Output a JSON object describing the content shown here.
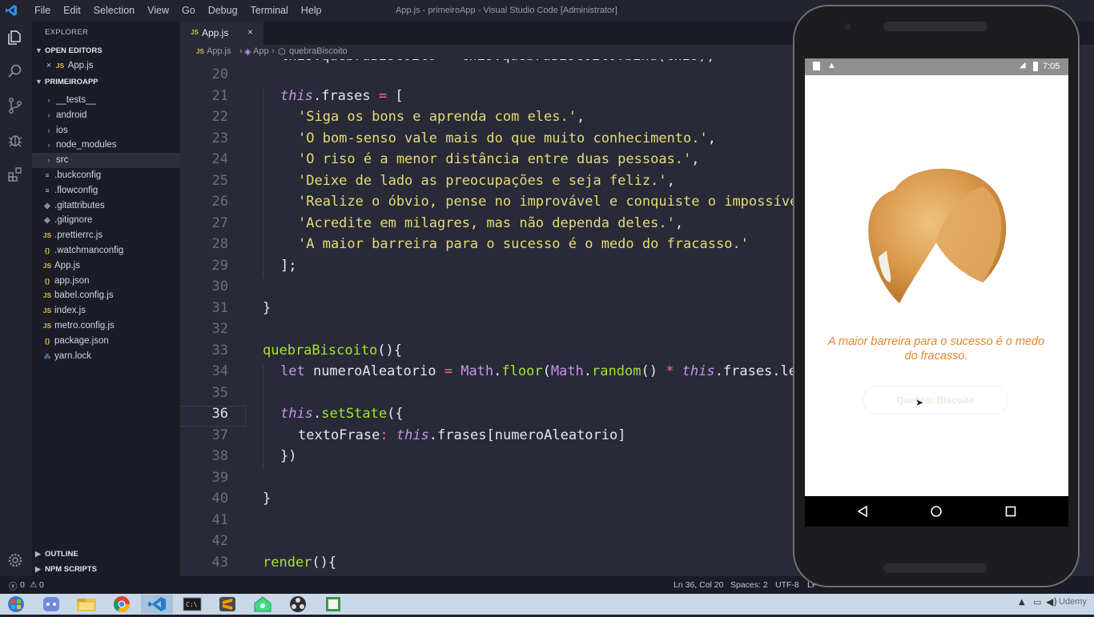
{
  "menu": [
    "File",
    "Edit",
    "Selection",
    "View",
    "Go",
    "Debug",
    "Terminal",
    "Help"
  ],
  "window_title": "App.js - primeiroApp - Visual Studio Code [Administrator]",
  "explorer": {
    "header": "EXPLORER",
    "open_editors_label": "OPEN EDITORS",
    "open_editors": [
      {
        "icon": "JS",
        "name": "App.js"
      }
    ],
    "project_label": "PRIMEIROAPP",
    "items": [
      {
        "type": "folder",
        "name": "__tests__"
      },
      {
        "type": "folder",
        "name": "android"
      },
      {
        "type": "folder",
        "name": "ios"
      },
      {
        "type": "folder",
        "name": "node_modules"
      },
      {
        "type": "folder",
        "name": "src"
      },
      {
        "type": "file",
        "icon": "≡",
        "name": ".buckconfig"
      },
      {
        "type": "file",
        "icon": "≡",
        "name": ".flowconfig"
      },
      {
        "type": "file",
        "icon": "◆",
        "name": ".gitattributes"
      },
      {
        "type": "file",
        "icon": "◆",
        "name": ".gitignore"
      },
      {
        "type": "file",
        "icon": "JS",
        "name": ".prettierrc.js"
      },
      {
        "type": "file",
        "icon": "{}",
        "name": ".watchmanconfig"
      },
      {
        "type": "file",
        "icon": "JS",
        "name": "App.js"
      },
      {
        "type": "file",
        "icon": "{}",
        "name": "app.json"
      },
      {
        "type": "file",
        "icon": "JS",
        "name": "babel.config.js"
      },
      {
        "type": "file",
        "icon": "JS",
        "name": "index.js"
      },
      {
        "type": "file",
        "icon": "JS",
        "name": "metro.config.js"
      },
      {
        "type": "file",
        "icon": "{}",
        "name": "package.json"
      },
      {
        "type": "file",
        "icon": "🧶",
        "name": "yarn.lock"
      }
    ],
    "outline_label": "OUTLINE",
    "npm_label": "NPM SCRIPTS"
  },
  "tab": {
    "icon": "JS",
    "name": "App.js",
    "close": "×"
  },
  "breadcrumb": [
    "App.js",
    "App",
    "quebraBiscoito"
  ],
  "editor": {
    "current_line": "36",
    "lines": [
      {
        "n": "20",
        "tokens": []
      },
      {
        "n": "21",
        "tokens": [
          [
            "kw",
            "this"
          ],
          [
            "punc",
            "."
          ],
          [
            "prop",
            "frases"
          ],
          [
            "op",
            " = "
          ],
          [
            "punc",
            "["
          ]
        ],
        "indent": 1
      },
      {
        "n": "22",
        "tokens": [
          [
            "str",
            "'Siga os bons e aprenda com eles.'"
          ],
          [
            "punc",
            ","
          ]
        ],
        "indent": 2
      },
      {
        "n": "23",
        "tokens": [
          [
            "str",
            "'O bom-senso vale mais do que muito conhecimento.'"
          ],
          [
            "punc",
            ","
          ]
        ],
        "indent": 2
      },
      {
        "n": "24",
        "tokens": [
          [
            "str",
            "'O riso é a menor distância entre duas pessoas.'"
          ],
          [
            "punc",
            ","
          ]
        ],
        "indent": 2
      },
      {
        "n": "25",
        "tokens": [
          [
            "str",
            "'Deixe de lado as preocupações e seja feliz.'"
          ],
          [
            "punc",
            ","
          ]
        ],
        "indent": 2
      },
      {
        "n": "26",
        "tokens": [
          [
            "str",
            "'Realize o óbvio, pense no improvável e conquiste o impossível.'"
          ],
          [
            "punc",
            ","
          ]
        ],
        "indent": 2
      },
      {
        "n": "27",
        "tokens": [
          [
            "str",
            "'Acredite em milagres, mas não dependa deles.'"
          ],
          [
            "punc",
            ","
          ]
        ],
        "indent": 2
      },
      {
        "n": "28",
        "tokens": [
          [
            "str",
            "'A maior barreira para o sucesso é o medo do fracasso.'"
          ]
        ],
        "indent": 2
      },
      {
        "n": "29",
        "tokens": [
          [
            "punc",
            "];"
          ]
        ],
        "indent": 1
      },
      {
        "n": "30",
        "tokens": []
      },
      {
        "n": "31",
        "tokens": [
          [
            "punc",
            "}"
          ]
        ],
        "indent": 0
      },
      {
        "n": "32",
        "tokens": []
      },
      {
        "n": "33",
        "tokens": [
          [
            "fn",
            "quebraBiscoito"
          ],
          [
            "punc",
            "(){"
          ]
        ],
        "indent": 0
      },
      {
        "n": "34",
        "tokens": [
          [
            "kw2",
            "let"
          ],
          [
            "ident",
            " numeroAleatorio "
          ],
          [
            "op",
            "="
          ],
          [
            "cls",
            " Math"
          ],
          [
            "punc",
            "."
          ],
          [
            "fn",
            "floor"
          ],
          [
            "punc",
            "("
          ],
          [
            "cls",
            "Math"
          ],
          [
            "punc",
            "."
          ],
          [
            "fn",
            "random"
          ],
          [
            "punc",
            "() "
          ],
          [
            "op",
            "*"
          ],
          [
            "kw",
            " this"
          ],
          [
            "punc",
            "."
          ],
          [
            "prop",
            "frases.length"
          ],
          [
            "punc",
            ");"
          ]
        ],
        "indent": 1
      },
      {
        "n": "35",
        "tokens": []
      },
      {
        "n": "36",
        "tokens": [
          [
            "kw",
            "this"
          ],
          [
            "punc",
            "."
          ],
          [
            "fn",
            "setState"
          ],
          [
            "punc",
            "({"
          ]
        ],
        "indent": 1
      },
      {
        "n": "37",
        "tokens": [
          [
            "prop",
            "textoFrase"
          ],
          [
            "op",
            ":"
          ],
          [
            "kw",
            " this"
          ],
          [
            "punc",
            "."
          ],
          [
            "prop",
            "frases"
          ],
          [
            "punc",
            "["
          ],
          [
            "ident",
            "numeroAleatorio"
          ],
          [
            "punc",
            "]"
          ]
        ],
        "indent": 2
      },
      {
        "n": "38",
        "tokens": [
          [
            "punc",
            "})"
          ]
        ],
        "indent": 1
      },
      {
        "n": "39",
        "tokens": []
      },
      {
        "n": "40",
        "tokens": [
          [
            "punc",
            "}"
          ]
        ],
        "indent": 0
      },
      {
        "n": "41",
        "tokens": []
      },
      {
        "n": "42",
        "tokens": []
      },
      {
        "n": "43",
        "tokens": [
          [
            "fn",
            "render"
          ],
          [
            "punc",
            "(){"
          ]
        ],
        "indent": 0
      }
    ],
    "partial_top": "this.quebraBiscoito = this.quebraBiscoito.bind(this);"
  },
  "statusbar": {
    "errors": "0",
    "warnings": "0",
    "position": "Ln 36, Col 20",
    "spaces": "Spaces: 2",
    "encoding": "UTF-8",
    "eol": "LF"
  },
  "phone": {
    "time": "7:05",
    "phrase": "A maior barreira para o sucesso é o medo do fracasso.",
    "button_label": "Quebrar Biscoito"
  },
  "taskbar": {
    "apps": [
      "start",
      "discord",
      "file-explorer",
      "chrome",
      "vscode",
      "terminal",
      "sublime",
      "android-studio",
      "obs",
      "notepad"
    ],
    "tray_text": "Udemy"
  },
  "colors": {
    "editor_bg": "#282a38",
    "string": "#e6db74",
    "keyword": "#c792ea",
    "function": "#a6e22e",
    "phrase": "#e0862f"
  }
}
